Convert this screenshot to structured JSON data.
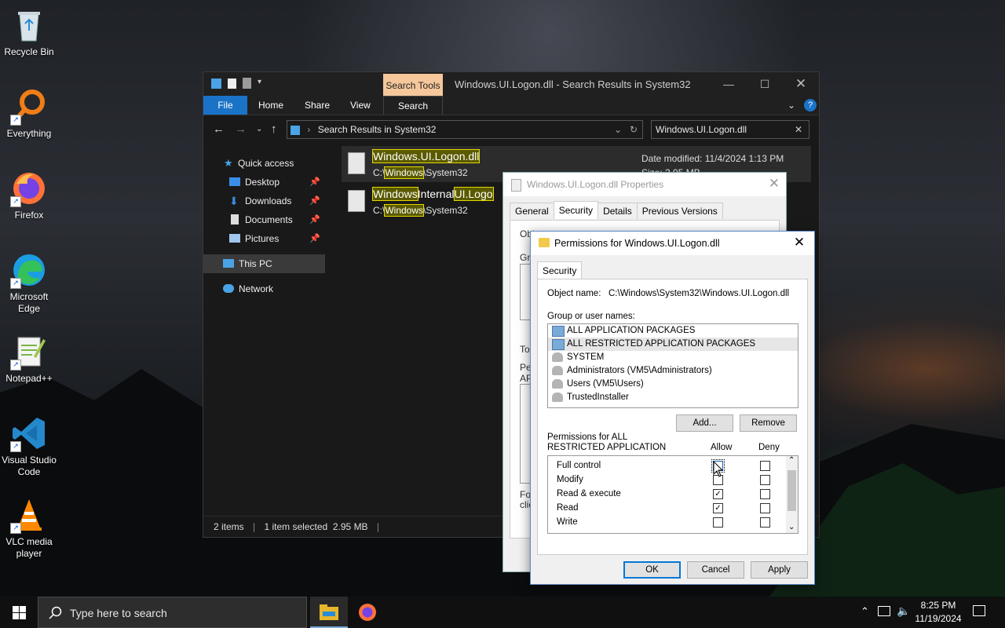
{
  "desktop": {
    "icons": [
      {
        "label_line1": "Recycle Bin",
        "label_line2": ""
      },
      {
        "label_line1": "Everything",
        "label_line2": ""
      },
      {
        "label_line1": "Firefox",
        "label_line2": ""
      },
      {
        "label_line1": "Microsoft",
        "label_line2": "Edge"
      },
      {
        "label_line1": "Notepad++",
        "label_line2": ""
      },
      {
        "label_line1": "Visual Studio",
        "label_line2": "Code"
      },
      {
        "label_line1": "VLC media",
        "label_line2": "player"
      }
    ]
  },
  "explorer": {
    "context_tab": "Search Tools",
    "title": "Windows.UI.Logon.dll - Search Results in System32",
    "ribbon": {
      "file": "File",
      "home": "Home",
      "share": "Share",
      "view": "View",
      "search": "Search"
    },
    "address": "Search Results in System32",
    "search_value": "Windows.UI.Logon.dll",
    "nav": {
      "quick_access": "Quick access",
      "desktop": "Desktop",
      "downloads": "Downloads",
      "documents": "Documents",
      "pictures": "Pictures",
      "this_pc": "This PC",
      "network": "Network"
    },
    "results": [
      {
        "name": "Windows.UI.Logon.dll",
        "path_pre": "C:\\",
        "path_hl": "Windows",
        "path_post": "\\System32",
        "meta1": "Date modified: 11/4/2024 1:13 PM",
        "meta2": "Size: 2.95 MB"
      },
      {
        "name_hl1": "Windows",
        "name_mid": "Internal",
        "name_hl2": "UI.Logo",
        "path_pre": "C:\\",
        "path_hl": "Windows",
        "path_post": "\\System32"
      }
    ],
    "status": {
      "items": "2 items",
      "selected": "1 item selected  2.95 MB"
    }
  },
  "properties": {
    "title": "Windows.UI.Logon.dll Properties",
    "tabs": [
      "General",
      "Security",
      "Details",
      "Previous Versions"
    ],
    "fragments": {
      "obj": "Object name:",
      "grp": "Gro",
      "to": "To",
      "pe": "Pe",
      "ap": "AP",
      "fo": "Fo",
      "cli": "clic"
    }
  },
  "permissions": {
    "title": "Permissions for Windows.UI.Logon.dll",
    "tab": "Security",
    "object_label": "Object name:",
    "object_value": "C:\\Windows\\System32\\Windows.UI.Logon.dll",
    "group_label": "Group or user names:",
    "groups": [
      {
        "name": "ALL APPLICATION PACKAGES",
        "selected": false
      },
      {
        "name": "ALL RESTRICTED APPLICATION PACKAGES",
        "selected": true
      },
      {
        "name": "SYSTEM",
        "selected": false
      },
      {
        "name": "Administrators (VM5\\Administrators)",
        "selected": false
      },
      {
        "name": "Users (VM5\\Users)",
        "selected": false
      },
      {
        "name": "TrustedInstaller",
        "selected": false
      }
    ],
    "add_button": "Add...",
    "remove_button": "Remove",
    "perm_label_line1": "Permissions for ALL",
    "perm_label_line2": "RESTRICTED APPLICATION",
    "allow_header": "Allow",
    "deny_header": "Deny",
    "rows": [
      {
        "name": "Full control",
        "allow": false,
        "deny": false
      },
      {
        "name": "Modify",
        "allow": false,
        "deny": false
      },
      {
        "name": "Read & execute",
        "allow": true,
        "deny": false
      },
      {
        "name": "Read",
        "allow": true,
        "deny": false
      },
      {
        "name": "Write",
        "allow": false,
        "deny": false
      }
    ],
    "ok": "OK",
    "cancel": "Cancel",
    "apply": "Apply"
  },
  "taskbar": {
    "search_placeholder": "Type here to search",
    "time": "8:25 PM",
    "date": "11/19/2024"
  },
  "colors": {
    "accent": "#0078d7",
    "search_tools_tab": "#f5c79b",
    "highlight_border": "#e6d800"
  },
  "icons": [
    "recycle-bin-icon",
    "everything-icon",
    "firefox-icon",
    "edge-icon",
    "notepadpp-icon",
    "vscode-icon",
    "vlc-icon",
    "windows-logo-icon",
    "search-icon",
    "file-explorer-icon",
    "notification-icon"
  ]
}
